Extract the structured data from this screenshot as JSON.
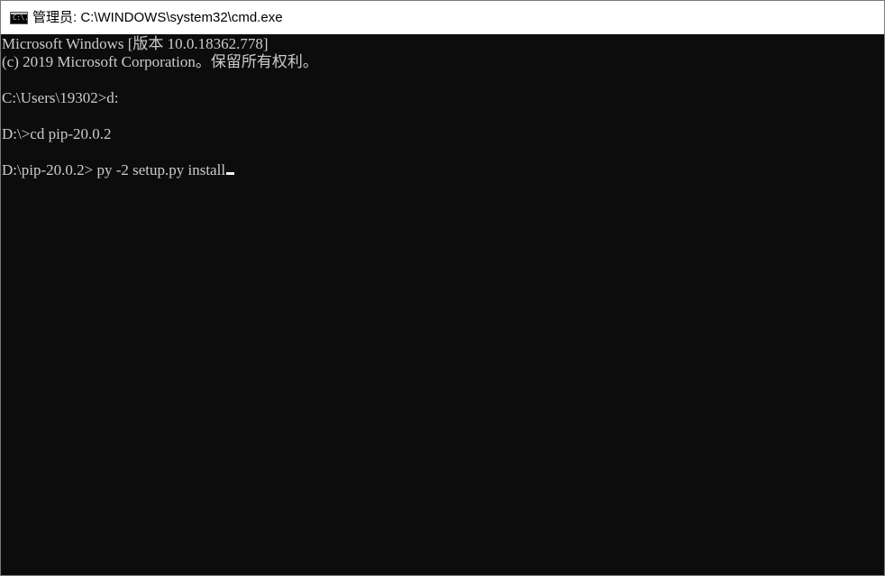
{
  "window": {
    "title": "管理员: C:\\WINDOWS\\system32\\cmd.exe",
    "icon": "cmd-console-icon",
    "icon_text": "C:\\."
  },
  "terminal": {
    "lines": [
      "Microsoft Windows [版本 10.0.18362.778]",
      "(c) 2019 Microsoft Corporation。保留所有权利。",
      "",
      "C:\\Users\\19302>d:",
      "",
      "D:\\>cd pip-20.0.2",
      "",
      "D:\\pip-20.0.2> "
    ],
    "current_input": "py -2 setup.py install"
  }
}
